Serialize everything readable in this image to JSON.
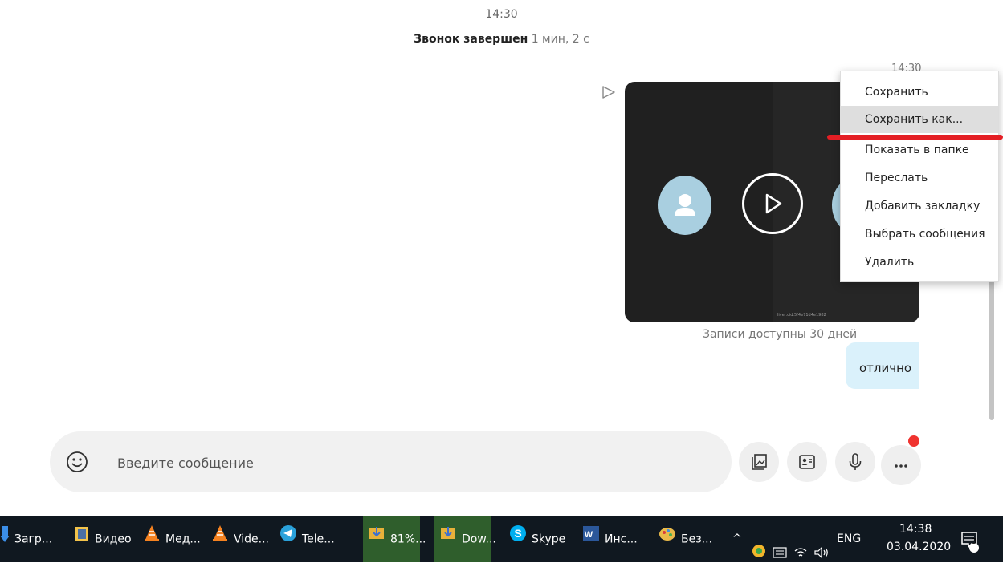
{
  "chat": {
    "call_time": "14:30",
    "call_status": "Звонок завершен",
    "call_duration": "1 мин, 2 с",
    "message_time": "14:30",
    "video_caption": "live:.cid.5f4e71d4e1982",
    "records_note": "Записи доступны 30 дней",
    "bubble_text": "отлично"
  },
  "context_menu": {
    "items": [
      "Сохранить",
      "Сохранить как...",
      "Показать в папке",
      "Переслать",
      "Добавить закладку",
      "Выбрать сообщения",
      "Удалить"
    ],
    "active_index": 1
  },
  "compose": {
    "placeholder": "Введите сообщение"
  },
  "taskbar": {
    "tasks": [
      {
        "label": "Загр...",
        "icon": "download-icon"
      },
      {
        "label": "Видео",
        "icon": "video-folder-icon"
      },
      {
        "label": "Мед...",
        "icon": "vlc-icon"
      },
      {
        "label": "Vide...",
        "icon": "vlc-icon"
      },
      {
        "label": "Tele...",
        "icon": "telegram-icon"
      },
      {
        "label": "81%...",
        "icon": "download-manager-icon"
      },
      {
        "label": "Dow...",
        "icon": "download-manager-icon"
      },
      {
        "label": "Skype",
        "icon": "skype-icon"
      },
      {
        "label": "Инс...",
        "icon": "word-icon"
      },
      {
        "label": "Без...",
        "icon": "paint-icon"
      }
    ],
    "language": "ENG",
    "time": "14:38",
    "date": "03.04.2020",
    "notifications_count": "3"
  },
  "colors": {
    "accent_red": "#e41e24",
    "bubble": "#daf1fb",
    "taskbar": "#101820",
    "skype_blue": "#00aff0"
  }
}
